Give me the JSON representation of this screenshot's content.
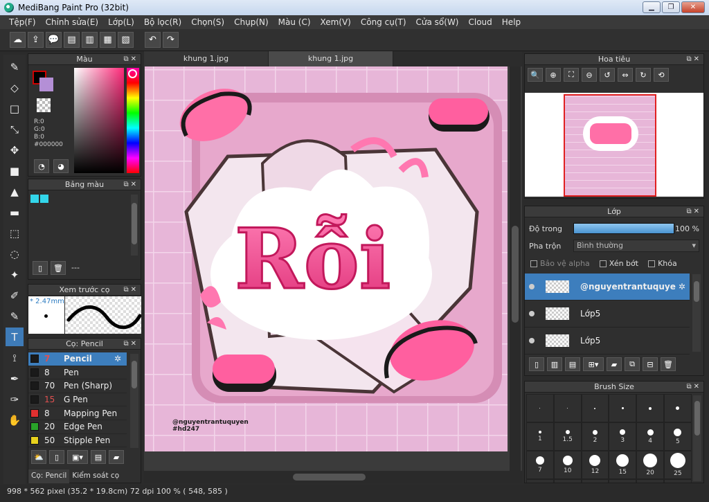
{
  "window": {
    "title": "MediBang Paint Pro (32bit)",
    "minimize": "▁",
    "restore": "❐",
    "close": "✕"
  },
  "menu": [
    "Tệp(F)",
    "Chỉnh sửa(E)",
    "Lớp(L)",
    "Bộ lọc(R)",
    "Chọn(S)",
    "Chụp(N)",
    "Màu (C)",
    "Xem(V)",
    "Công cụ(T)",
    "Cửa sổ(W)",
    "Cloud",
    "Help"
  ],
  "toolbar": {
    "cloud": "☁",
    "share": "⇪",
    "comment": "💬",
    "note": "▤",
    "doc": "▥",
    "grid": "▦",
    "panel": "▧",
    "undo": "↶",
    "redo": "↷"
  },
  "tools": [
    "✎",
    "◇",
    "□",
    "⤡",
    "✥",
    "■",
    "▲",
    "▬",
    "⬚",
    "◌",
    "✦",
    "✐",
    "✎",
    "T",
    "⟟",
    "✒",
    "✑",
    "✋"
  ],
  "color_panel": {
    "title": "Màu",
    "r": "R:0",
    "g": "G:0",
    "b": "B:0",
    "hex": "#000000",
    "fg": "#000000",
    "bg": "#b48fd6"
  },
  "palette_panel": {
    "title": "Bảng màu",
    "count": "---",
    "swatches": [
      "#33d6ea",
      "#33d6ea"
    ]
  },
  "brush_preview_panel": {
    "title": "Xem trước cọ",
    "size": "* 2.47mm"
  },
  "brush_panel": {
    "title": "Cọ: Pencil",
    "items": [
      {
        "num": "7",
        "name": "Pencil",
        "color": "#1a1a1a",
        "num_color": "#e05050"
      },
      {
        "num": "8",
        "name": "Pen",
        "color": "#1a1a1a",
        "num_color": "#eeeeee"
      },
      {
        "num": "70",
        "name": "Pen (Sharp)",
        "color": "#1a1a1a",
        "num_color": "#eeeeee"
      },
      {
        "num": "15",
        "name": "G Pen",
        "color": "#1a1a1a",
        "num_color": "#e05050"
      },
      {
        "num": "8",
        "name": "Mapping Pen",
        "color": "#e03030",
        "num_color": "#eeeeee"
      },
      {
        "num": "20",
        "name": "Edge Pen",
        "color": "#29a329",
        "num_color": "#eeeeee"
      },
      {
        "num": "50",
        "name": "Stipple Pen",
        "color": "#e8d21e",
        "num_color": "#eeeeee"
      }
    ],
    "bottom_tabs": [
      "Cọ: Pencil",
      "Kiểm soát cọ"
    ]
  },
  "canvas": {
    "tabs": [
      "khung 1.jpg",
      "khung 1.jpg"
    ],
    "art_text": "Rỗi",
    "credit_line1": "@nguyentrantuquyen",
    "credit_line2": "#hd247"
  },
  "navigator_panel": {
    "title": "Hoa tiêu"
  },
  "layer_panel": {
    "title": "Lớp",
    "opacity_label": "Độ trong",
    "opacity_value": "100 %",
    "opacity": 1.0,
    "blend_label": "Pha trộn",
    "blend_value": "Bình thường",
    "protect_alpha": "Bảo vệ alpha",
    "clipping": "Xén bớt",
    "lock": "Khóa",
    "layers": [
      {
        "name": "@nguyentrantuquye",
        "selected": true
      },
      {
        "name": "Lớp5",
        "selected": false
      },
      {
        "name": "Lớp5",
        "selected": false
      }
    ]
  },
  "brush_size_panel": {
    "title": "Brush Size",
    "sizes": [
      "",
      "",
      "",
      "",
      "",
      "",
      "1",
      "1.5",
      "2",
      "3",
      "4",
      "5",
      "7",
      "10",
      "12",
      "15",
      "20",
      "25",
      "",
      "",
      "",
      "",
      "",
      ""
    ]
  },
  "status": {
    "text": "998 * 562 pixel   (35.2 * 19.8cm)   72 dpi   100 %   ( 548, 585 )"
  }
}
